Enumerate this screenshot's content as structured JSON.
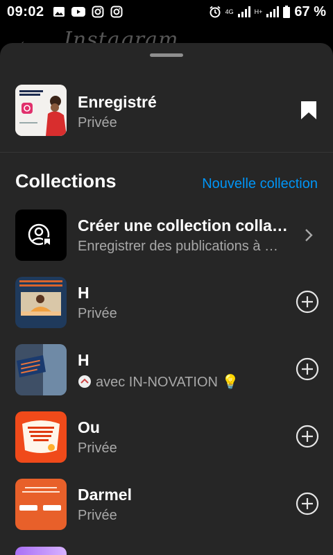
{
  "status_bar": {
    "time": "09:02",
    "left_icons": [
      "gallery-icon",
      "youtube-icon",
      "instagram-icon",
      "instagram-icon"
    ],
    "network_label": "4G",
    "network_label_2": "H+",
    "battery": "67 %"
  },
  "background_app": {
    "logo": "Instagram"
  },
  "saved": {
    "title": "Enregistré",
    "subtitle": "Privée"
  },
  "collections": {
    "heading": "Collections",
    "new_collection": "Nouvelle collection",
    "create_collab": {
      "title": "Créer une collection collaborative",
      "subtitle": "Enregistrer des publications à plusieurs"
    },
    "items": [
      {
        "title": "H",
        "subtitle": "Privée"
      },
      {
        "title": "H",
        "subtitle": "avec IN-NOVATION 💡"
      },
      {
        "title": "Ou",
        "subtitle": "Privée"
      },
      {
        "title": "Darmel",
        "subtitle": "Privée"
      }
    ]
  },
  "colors": {
    "sheet_bg": "#262626",
    "accent_blue": "#0095f6",
    "secondary_text": "#a8a8a8"
  }
}
